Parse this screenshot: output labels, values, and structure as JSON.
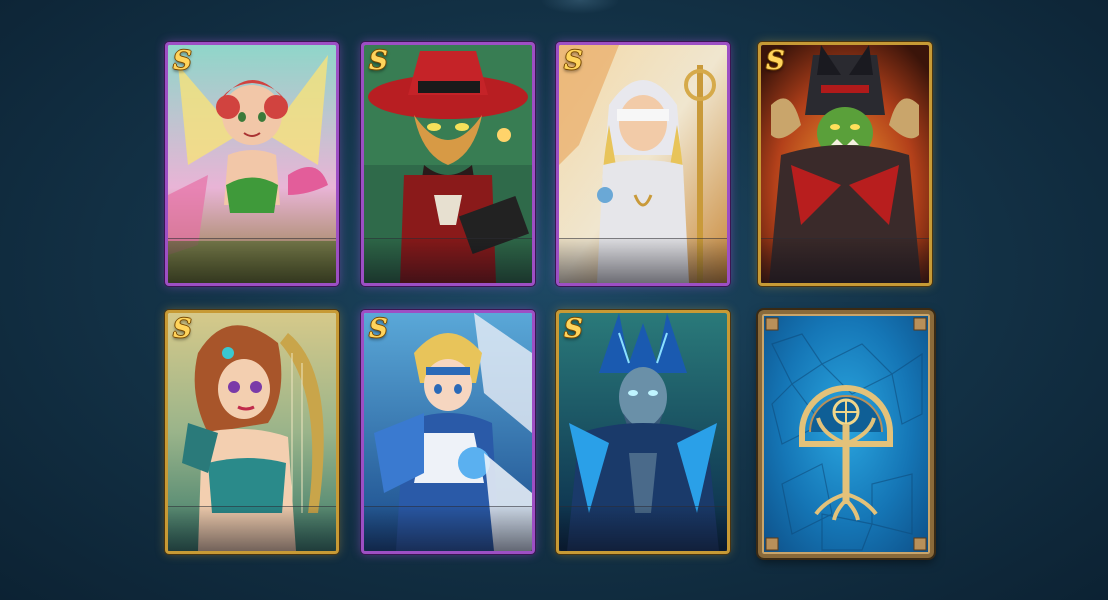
{
  "screen": {
    "accent_purple": "#9d4fc4",
    "accent_gold": "#c79a35",
    "background": "#143449"
  },
  "cards": [
    {
      "rank": "S",
      "frame": "purple",
      "portrait": "fairy-heroine-portrait"
    },
    {
      "rank": "S",
      "frame": "purple",
      "portrait": "cat-gunslinger-portrait"
    },
    {
      "rank": "S",
      "frame": "purple",
      "portrait": "blindfolded-priestess-portrait"
    },
    {
      "rank": "S",
      "frame": "gold",
      "portrait": "orc-warlord-portrait"
    },
    {
      "rank": "S",
      "frame": "gold",
      "portrait": "elf-harpist-portrait"
    },
    {
      "rank": "S",
      "frame": "purple",
      "portrait": "winged-knight-portrait"
    },
    {
      "rank": "S",
      "frame": "gold",
      "portrait": "frost-demon-lord-portrait"
    }
  ],
  "card_back": {
    "emblem": "tree-of-life-icon",
    "frame": "bronze"
  }
}
